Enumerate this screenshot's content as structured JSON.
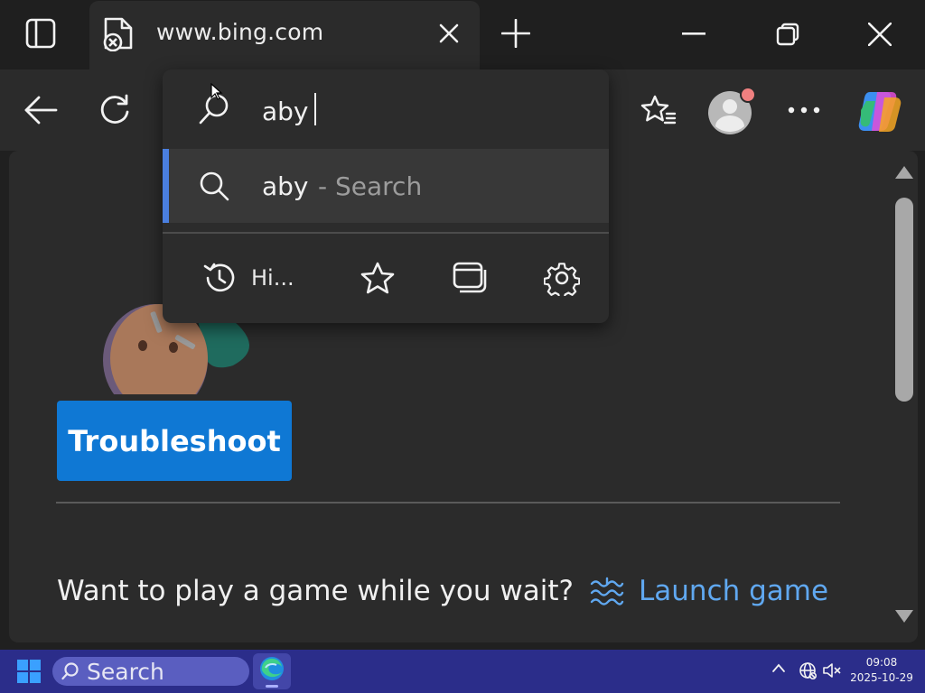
{
  "browser": {
    "tab": {
      "title": "www.bing.com",
      "favicon": "broken-page-icon"
    },
    "toolbar": {
      "icons": [
        "back-arrow-icon",
        "refresh-icon",
        "favorites-star-icon",
        "profile-avatar-icon",
        "more-icon",
        "copilot-icon"
      ]
    }
  },
  "omnibox": {
    "input_value": "aby",
    "suggestion": {
      "query": "aby",
      "hint": "- Search"
    },
    "shortcuts": {
      "history_label": "Hi..."
    }
  },
  "page": {
    "troubleshoot_label": "Troubleshoot",
    "game_prompt": "Want to play a game while you wait?",
    "launch_game_label": "Launch game"
  },
  "taskbar": {
    "search_label": "Search",
    "time": "09:08",
    "date": "2025-10-29"
  },
  "colors": {
    "accent_button": "#0f78d4",
    "link": "#60a8f0",
    "suggestion_accent": "#4a7fe0",
    "taskbar": "#2b2d8a"
  }
}
